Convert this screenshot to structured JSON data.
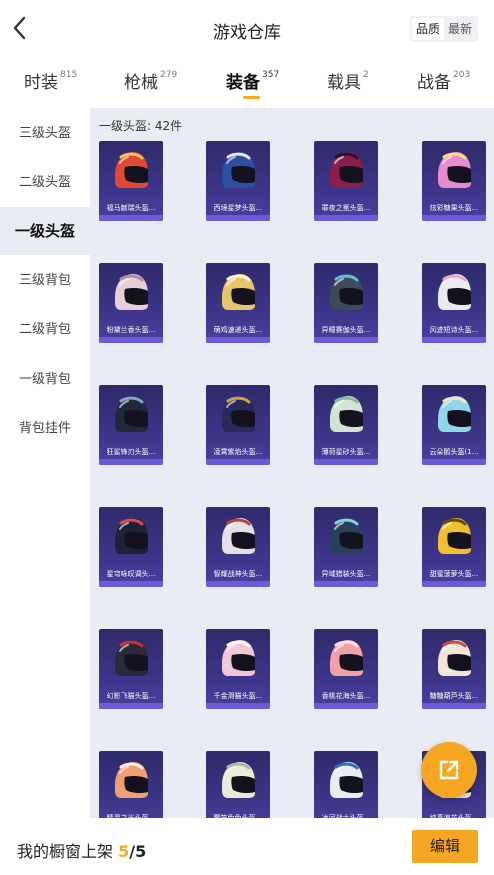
{
  "header": {
    "title": "游戏仓库",
    "sort_options": [
      "品质",
      "最新"
    ],
    "sort_active": "品质"
  },
  "tabs": [
    {
      "label": "时装",
      "count": "815"
    },
    {
      "label": "枪械",
      "count": "279"
    },
    {
      "label": "装备",
      "count": "357",
      "active": true
    },
    {
      "label": "载具",
      "count": "2"
    },
    {
      "label": "战备",
      "count": "203"
    }
  ],
  "sidebar": {
    "items": [
      "三级头盔",
      "二级头盔",
      "一级头盔",
      "三级背包",
      "二级背包",
      "一级背包",
      "背包挂件"
    ],
    "active": "一级头盔"
  },
  "group": {
    "title": "一级头盔: 42件"
  },
  "items": [
    {
      "name": "福马献瑞头盔...",
      "color": "#e04a32",
      "accent": "#f2c14e"
    },
    {
      "name": "西境星梦头盔...",
      "color": "#2c4f9e",
      "accent": "#e8e8ff"
    },
    {
      "name": "罪夜之冕头盔...",
      "color": "#8a1f4a",
      "accent": "#2a1030"
    },
    {
      "name": "炫彩糖果头盔...",
      "color": "#e58bd0",
      "accent": "#f7e36a"
    },
    {
      "name": "粉黛兰香头盔...",
      "color": "#e6cfd6",
      "accent": "#b58c9a"
    },
    {
      "name": "萌鸡速递头盔...",
      "color": "#e8c56a",
      "accent": "#fff5d0"
    },
    {
      "name": "异瞳赛伽头盔...",
      "color": "#3d4a58",
      "accent": "#58c3e0"
    },
    {
      "name": "风迹短诗头盔...",
      "color": "#eaeaf0",
      "accent": "#f0a9c4"
    },
    {
      "name": "狂鲨锋刃头盔...",
      "color": "#1e2a3a",
      "accent": "#7fa6c9"
    },
    {
      "name": "凌霄紫焰头盔...",
      "color": "#2a2a5a",
      "accent": "#c9a24a"
    },
    {
      "name": "薄荷星砂头盔...",
      "color": "#cfe6d6",
      "accent": "#7fbf9a"
    },
    {
      "name": "云朵鹅头盔(1...",
      "color": "#8fd6e8",
      "accent": "#f6e6b6"
    },
    {
      "name": "星穹咏叹调头...",
      "color": "#1e2236",
      "accent": "#e04a4a"
    },
    {
      "name": "智耀战神头盔...",
      "color": "#e6e0e6",
      "accent": "#c04040"
    },
    {
      "name": "异域猎装头盔...",
      "color": "#28405a",
      "accent": "#7fd6e0"
    },
    {
      "name": "甜蜜菠萝头盔...",
      "color": "#f0c030",
      "accent": "#6b4a10"
    },
    {
      "name": "幻影飞猫头盔...",
      "color": "#2a2a3a",
      "accent": "#d03030"
    },
    {
      "name": "千金滑猫头盔...",
      "color": "#f3c6d6",
      "accent": "#ffffff"
    },
    {
      "name": "香桃花海头盔...",
      "color": "#f0a0a8",
      "accent": "#ffe0e6"
    },
    {
      "name": "糖糖葫芦头盔...",
      "color": "#f3e6d6",
      "accent": "#d04a3a"
    },
    {
      "name": "精灵之光头盔...",
      "color": "#f0a070",
      "accent": "#fff0e0"
    },
    {
      "name": "警笛兔兔头盔...",
      "color": "#e6ecd6",
      "accent": "#b0b8a0"
    },
    {
      "name": "冰河战士头盔...",
      "color": "#e8ecf4",
      "accent": "#2a70c0"
    },
    {
      "name": "纯真浪花头盔...",
      "color": "#f0e6d0",
      "accent": "#c04a3a"
    }
  ],
  "share_icon": "share-external-icon",
  "bottom": {
    "label": "我的橱窗上架",
    "count": "5",
    "total": "/5",
    "edit_label": "编辑"
  },
  "colors": {
    "accent": "#f5a623",
    "card_bg": "#3b3485",
    "panel_bg": "#e9edf3"
  }
}
